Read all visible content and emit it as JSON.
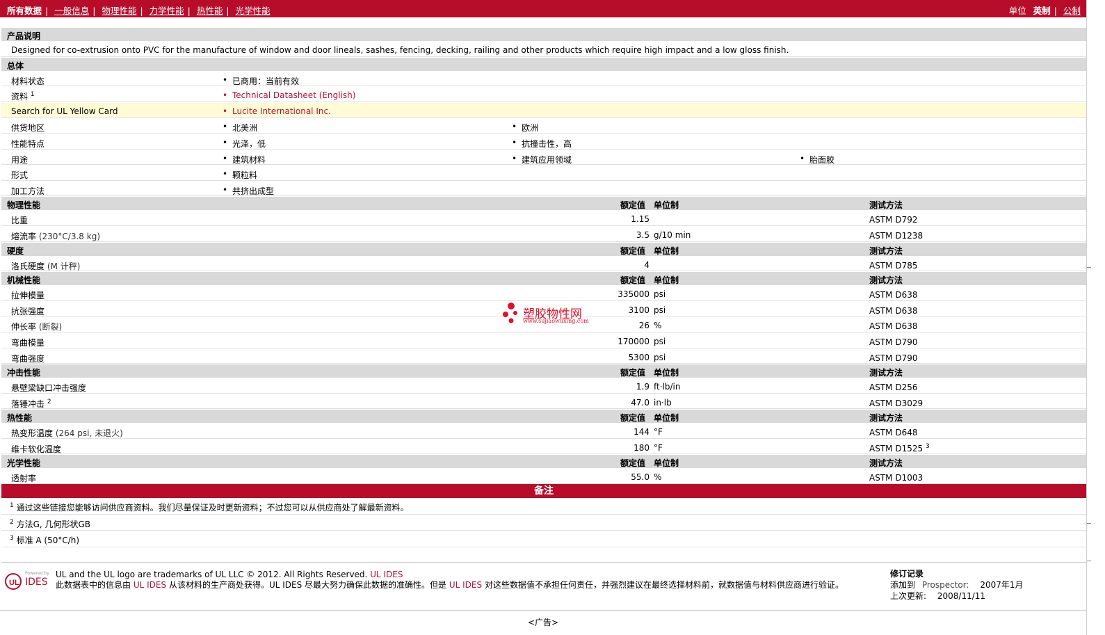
{
  "nav": {
    "all": "所有数据",
    "links": [
      "一般信息",
      "物理性能",
      "力学性能",
      "热性能",
      "光学性能"
    ],
    "units_label": "单位",
    "unit_imperial": "英制",
    "unit_metric": "公制"
  },
  "description": {
    "title": "产品说明",
    "text": "Designed for co-extrusion onto PVC for the manufacture of window and door lineals, sashes, fencing, decking, railing and other products which require high impact and a low gloss finish."
  },
  "general": {
    "title": "总体",
    "material_status_label": "材料状态",
    "material_status": "已商用：当前有效",
    "documents_label": "资料",
    "documents_sup": "1",
    "documents_link": "Technical Datasheet (English)",
    "yellow_card_label": "Search for UL Yellow Card",
    "yellow_card_link": "Lucite International Inc.",
    "availability_label": "供货地区",
    "availability": [
      "北美洲",
      "欧洲"
    ],
    "features_label": "性能特点",
    "features": [
      "光泽，低",
      "抗撞击性，高"
    ],
    "uses_label": "用途",
    "uses": [
      "建筑材料",
      "建筑应用领域",
      "胎面胶"
    ],
    "forms_label": "形式",
    "forms": "颗粒料",
    "processing_label": "加工方法",
    "processing": "共挤出成型"
  },
  "headers": {
    "nominal": "额定值",
    "unit": "单位制",
    "method": "测试方法"
  },
  "sections": [
    {
      "title": "物理性能",
      "rows": [
        {
          "label": "比重",
          "cond": "",
          "sup": "",
          "value": "1.15",
          "unit": "",
          "method": "ASTM D792",
          "method_sup": ""
        },
        {
          "label": "熔流率",
          "cond": "(230°C/3.8 kg)",
          "sup": "",
          "value": "3.5",
          "unit": "g/10 min",
          "method": "ASTM D1238",
          "method_sup": ""
        }
      ]
    },
    {
      "title": "硬度",
      "rows": [
        {
          "label": "洛氏硬度",
          "cond": "(M 计秤)",
          "sup": "",
          "value": "4",
          "unit": "",
          "method": "ASTM D785",
          "method_sup": ""
        }
      ]
    },
    {
      "title": "机械性能",
      "rows": [
        {
          "label": "拉伸模量",
          "cond": "",
          "sup": "",
          "value": "335000",
          "unit": "psi",
          "method": "ASTM D638",
          "method_sup": ""
        },
        {
          "label": "抗张强度",
          "cond": "",
          "sup": "",
          "value": "3100",
          "unit": "psi",
          "method": "ASTM D638",
          "method_sup": ""
        },
        {
          "label": "伸长率",
          "cond": "(断裂)",
          "sup": "",
          "value": "26",
          "unit": "%",
          "method": "ASTM D638",
          "method_sup": ""
        },
        {
          "label": "弯曲模量",
          "cond": "",
          "sup": "",
          "value": "170000",
          "unit": "psi",
          "method": "ASTM D790",
          "method_sup": ""
        },
        {
          "label": "弯曲强度",
          "cond": "",
          "sup": "",
          "value": "5300",
          "unit": "psi",
          "method": "ASTM D790",
          "method_sup": ""
        }
      ]
    },
    {
      "title": "冲击性能",
      "rows": [
        {
          "label": "悬壁梁缺口冲击强度",
          "cond": "",
          "sup": "",
          "value": "1.9",
          "unit": "ft·lb/in",
          "method": "ASTM D256",
          "method_sup": ""
        },
        {
          "label": "落锤冲击",
          "cond": "",
          "sup": "2",
          "value": "47.0",
          "unit": "in·lb",
          "method": "ASTM D3029",
          "method_sup": ""
        }
      ]
    },
    {
      "title": "热性能",
      "rows": [
        {
          "label": "热变形温度",
          "cond": "(264 psi, 未退火)",
          "sup": "",
          "value": "144",
          "unit": "°F",
          "method": "ASTM D648",
          "method_sup": ""
        },
        {
          "label": "维卡软化温度",
          "cond": "",
          "sup": "",
          "value": "180",
          "unit": "°F",
          "method": "ASTM D1525",
          "method_sup": "3"
        }
      ]
    },
    {
      "title": "光学性能",
      "rows": [
        {
          "label": "透射率",
          "cond": "",
          "sup": "",
          "value": "55.0",
          "unit": "%",
          "method": "ASTM D1003",
          "method_sup": ""
        }
      ]
    }
  ],
  "notes": {
    "title": "备注",
    "items": [
      {
        "n": "1",
        "text": "通过这些链接您能够访问供应商资料。我们尽量保证及时更新资料；不过您可以从供应商处了解最新资料。"
      },
      {
        "n": "2",
        "text": "方法G, 几何形状GB"
      },
      {
        "n": "3",
        "text": "标准 A (50°C/h)"
      }
    ]
  },
  "watermark": {
    "name": "塑胶物性网",
    "url": "www.sujiaowuxing.com"
  },
  "footer": {
    "logo_small": "Powered by",
    "logo_text": "IDES",
    "trademark": "UL and the UL logo are trademarks of UL LLC © 2012. All Rights Reserved.",
    "trademark_link": "UL IDES",
    "disclaimer_a": "此数据表中的信息由",
    "disclaimer_link1": "UL IDES",
    "disclaimer_b": "从该材料的生产商处获得。UL IDES 尽最大努力确保此数据的准确性。但是",
    "disclaimer_link2": "UL IDES",
    "disclaimer_c": "对这些数据值不承担任何责任，并强烈建议在最终选择材料前，就数据值与材料供应商进行验证。",
    "rev_title": "修订记录",
    "added_label": "添加到",
    "added_link": "Prospector:",
    "added_date": "2007年1月",
    "updated_label": "上次更新:",
    "updated_date": "2008/11/11",
    "ad": "<广告>"
  },
  "colors": {
    "brand_red": "#b70d2a",
    "link": "#b0123a",
    "section_bg": "#d9d9d9",
    "highlight_row": "#fffbd4"
  }
}
